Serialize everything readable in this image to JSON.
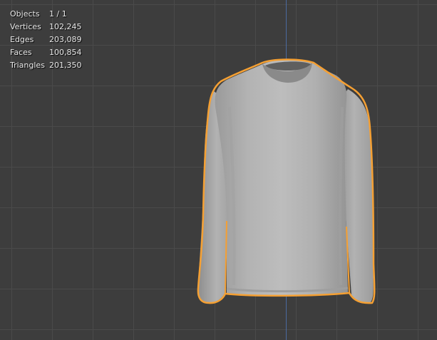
{
  "stats": {
    "rows": [
      {
        "label": "Objects",
        "value": "1 / 1"
      },
      {
        "label": "Vertices",
        "value": "102,245"
      },
      {
        "label": "Edges",
        "value": "203,089"
      },
      {
        "label": "Faces",
        "value": "100,854"
      },
      {
        "label": "Triangles",
        "value": "201,350"
      }
    ]
  },
  "colors": {
    "background": "#3d3d3d",
    "grid": "#4a4a4a",
    "axis": "#4b6aa0",
    "selection_outline": "#f5a033",
    "mesh": "#b5b5b5"
  },
  "scene": {
    "object_icon": "long-sleeve-shirt-mesh",
    "selected": true
  }
}
